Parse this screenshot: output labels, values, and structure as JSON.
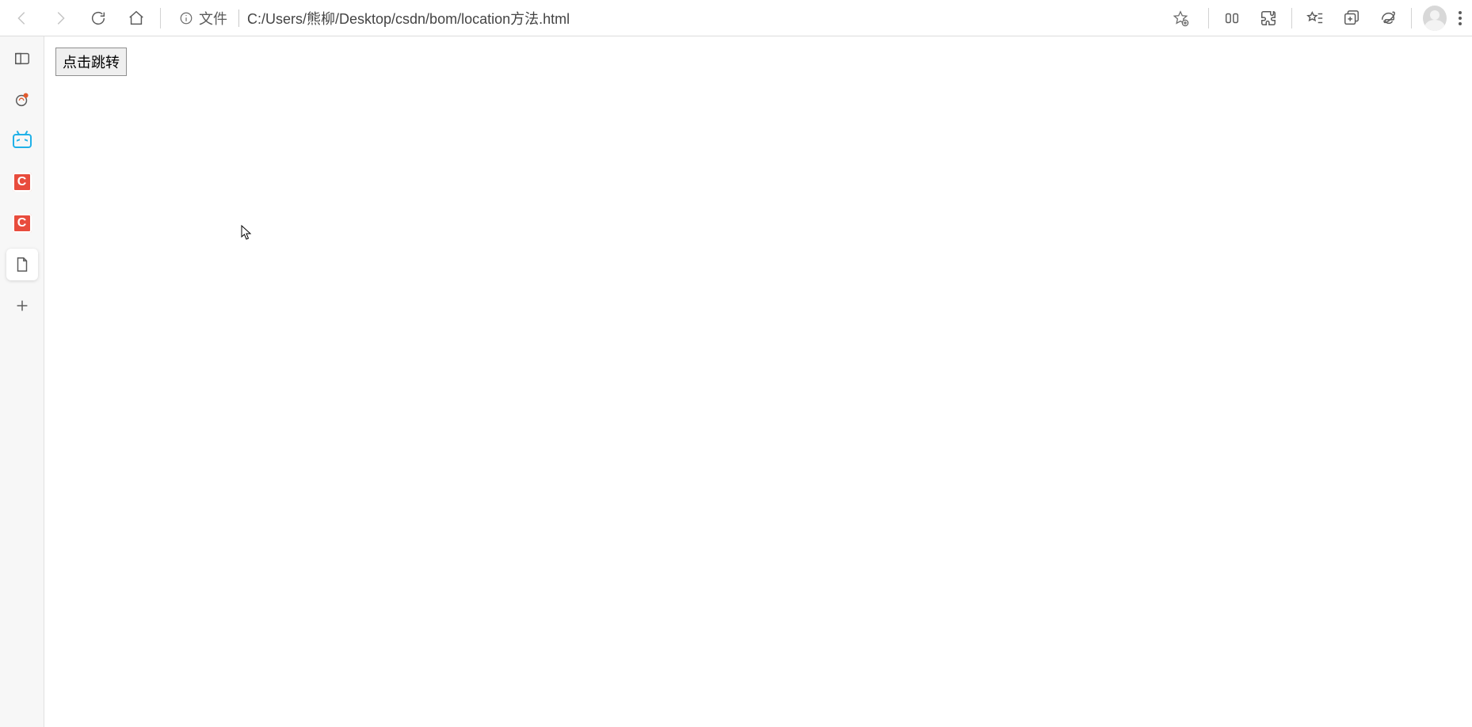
{
  "toolbar": {
    "address_label": "文件",
    "url": "C:/Users/熊柳/Desktop/csdn/bom/location方法.html"
  },
  "sidebar": {
    "items": [
      {
        "name": "tab-manager"
      },
      {
        "name": "extension-tab"
      },
      {
        "name": "bilibili-tab"
      },
      {
        "name": "csdn-tab-1",
        "glyph": "C"
      },
      {
        "name": "csdn-tab-2",
        "glyph": "C"
      },
      {
        "name": "current-file-tab"
      },
      {
        "name": "new-tab"
      }
    ]
  },
  "page": {
    "button_label": "点击跳转"
  }
}
